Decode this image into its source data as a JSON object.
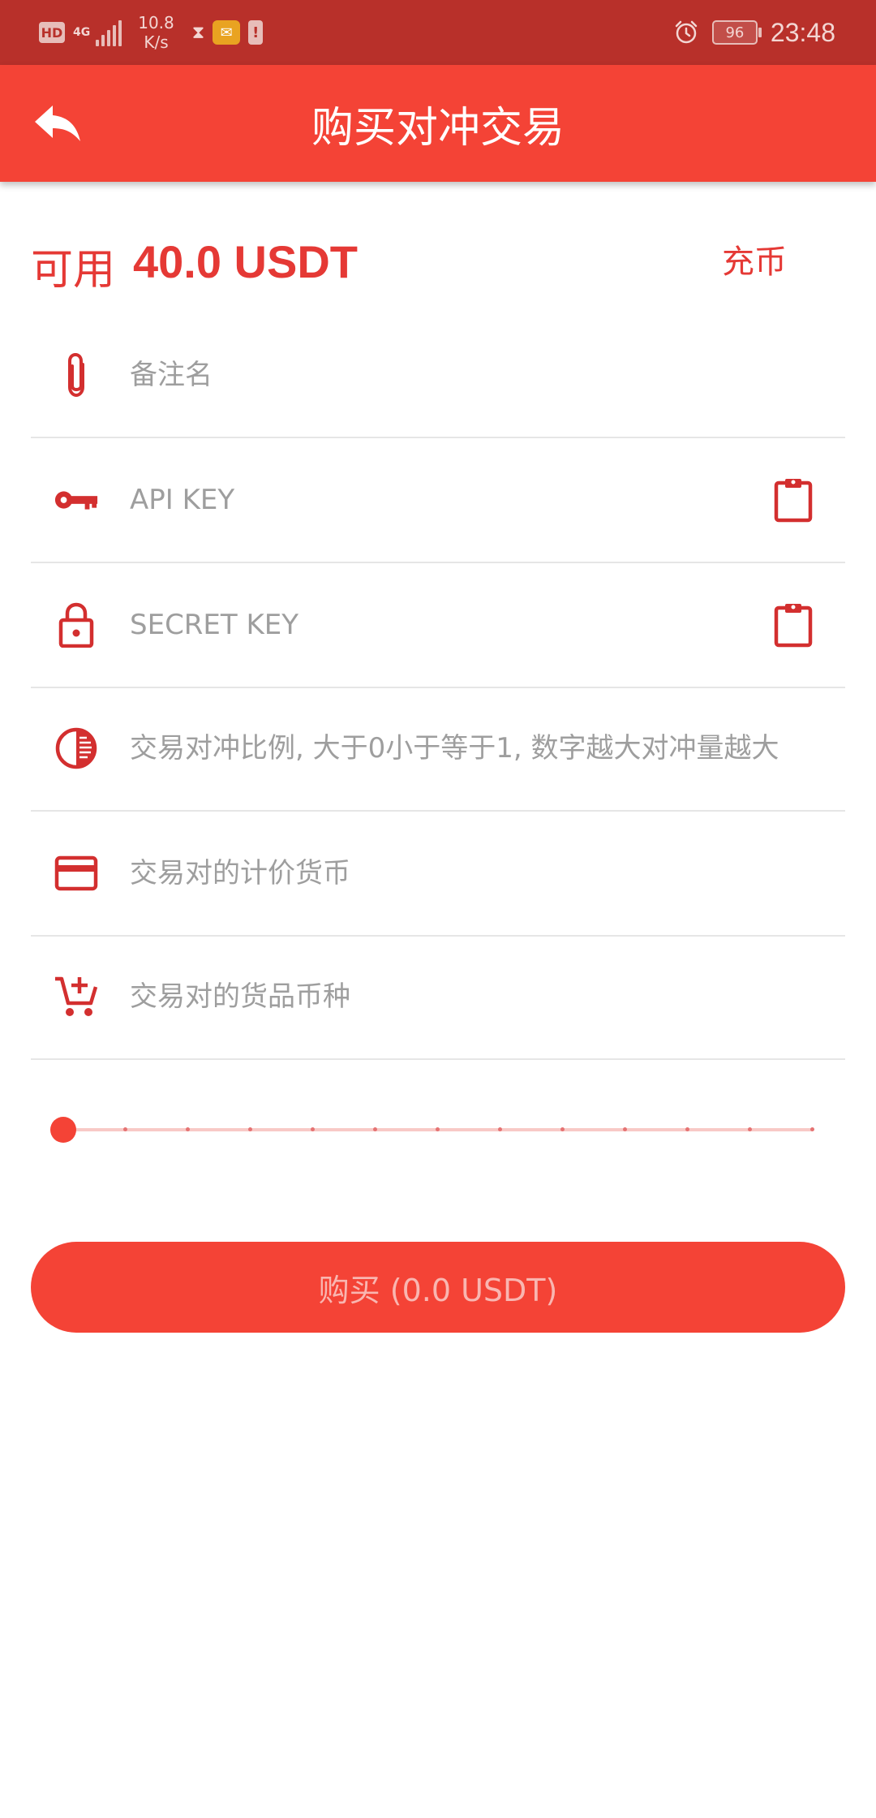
{
  "status_bar": {
    "hd_label": "HD",
    "network_label": "4G",
    "speed_value": "10.8",
    "speed_unit": "K/s",
    "battery_level": "96",
    "time": "23:48"
  },
  "app_bar": {
    "title": "购买对冲交易",
    "back_icon": "reply-arrow-icon"
  },
  "balance": {
    "prefix": "可用",
    "amount": "40.0 USDT",
    "deposit_label": "充币"
  },
  "fields": {
    "remark": {
      "placeholder": "备注名",
      "icon": "paperclip-icon",
      "value": ""
    },
    "api_key": {
      "placeholder": "API KEY",
      "icon": "key-icon",
      "value": "",
      "paste_icon": "clipboard-icon"
    },
    "secret_key": {
      "placeholder": "SECRET KEY",
      "icon": "lock-icon",
      "value": "",
      "paste_icon": "clipboard-icon"
    },
    "hedge_ratio": {
      "placeholder": "交易对冲比例, 大于0小于等于1, 数字越大对冲量越大",
      "icon": "contrast-icon",
      "value": ""
    },
    "quote_currency": {
      "placeholder": "交易对的计价货币",
      "icon": "credit-card-icon",
      "value": ""
    },
    "base_currency": {
      "placeholder": "交易对的货品币种",
      "icon": "add-cart-icon",
      "value": ""
    }
  },
  "slider": {
    "value_fraction": 0,
    "steps": 12
  },
  "buy_button": {
    "label": "购买 (0.0 USDT)"
  },
  "colors": {
    "primary": "#f44336",
    "status_bar": "#b8302a",
    "accent_text": "#e53935",
    "placeholder": "#9e9e9e"
  }
}
